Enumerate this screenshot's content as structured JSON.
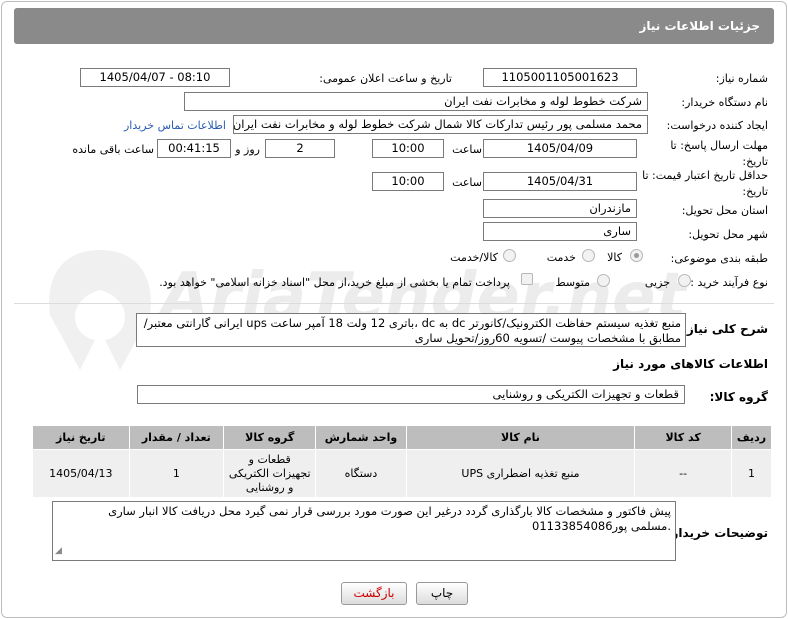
{
  "header": {
    "title": "جزئیات اطلاعات نیاز"
  },
  "fields": {
    "need_number_label": "شماره نیاز:",
    "need_number": "1105001105001623",
    "announce_label": "تاریخ و ساعت اعلان عمومی:",
    "announce_value": "1405/04/07 - 08:10",
    "buyer_org_label": "نام دستگاه خریدار:",
    "buyer_org": "شرکت خطوط لوله و مخابرات نفت ایران",
    "requester_label": "ایجاد کننده درخواست:",
    "requester": "محمد مسلمی پور رئیس تدارکات کالا شمال شرکت خطوط لوله و مخابرات نفت ایران",
    "contact_link": "اطلاعات تماس خریدار",
    "deadline_label": "مهلت ارسال پاسخ: تا تاریخ:",
    "deadline_date": "1405/04/09",
    "time_label": "ساعت",
    "deadline_time": "10:00",
    "days_value": "2",
    "days_label": "روز و",
    "remaining_time": "00:41:15",
    "remaining_label": "ساعت باقی مانده",
    "validity_label": "حداقل تاریخ اعتبار قیمت: تا تاریخ:",
    "validity_date": "1405/04/31",
    "validity_time": "10:00",
    "province_label": "استان محل تحویل:",
    "province": "مازندران",
    "city_label": "شهر محل تحویل:",
    "city": "ساری",
    "category_label": "طبقه بندی موضوعی:",
    "category_options": [
      "کالا",
      "خدمت",
      "کالا/خدمت"
    ],
    "process_label": "نوع فرآیند خرید :",
    "process_options": [
      "جزیی",
      "متوسط"
    ],
    "payment_note": "پرداخت تمام یا بخشی از مبلغ خرید،از محل \"اسناد خزانه اسلامی\" خواهد بود."
  },
  "description": {
    "label": "شرح کلی نیاز:",
    "line1": "منبع تغذیه سیستم حفاظت الکترونیک/کانورتر dc به dc ،باتری 12 ولت 18 آمپر ساعت ups ایرانی گارانتی معتبر/",
    "line2": "مطابق با مشخصات پیوست /تسویه 60روز/تحویل  ساری"
  },
  "goods": {
    "section_title": "اطلاعات کالاهای مورد نیاز",
    "group_label": "گروه کالا:",
    "group_value": "قطعات و تجهیزات الکتریکی و روشنایی",
    "columns": [
      "ردیف",
      "کد کالا",
      "نام کالا",
      "واحد شمارش",
      "گروه کالا",
      "تعداد / مقدار",
      "تاریخ نیاز"
    ],
    "rows": [
      {
        "row": "1",
        "code": "--",
        "name": "منبع تغذیه اضطراری UPS",
        "unit": "دستگاه",
        "group": "قطعات و تجهیزات الکتریکی و روشنایی",
        "qty": "1",
        "date": "1405/04/13"
      }
    ]
  },
  "buyer_notes": {
    "label": "توضیحات خریدار:",
    "line1": "پیش فاکتور و مشخصات کالا بارگذاری گردد درغیر این صورت مورد بررسی قرار نمی گیرد محل دریافت کالا انبار ساری",
    "line2": ".مسلمی پور01133854086"
  },
  "buttons": {
    "print": "چاپ",
    "back": "بازگشت"
  },
  "watermark": "AriaTender.net",
  "colors": {
    "header_bg": "#8a8a8a",
    "link": "#2a5db0",
    "back_text": "#cc0000"
  }
}
